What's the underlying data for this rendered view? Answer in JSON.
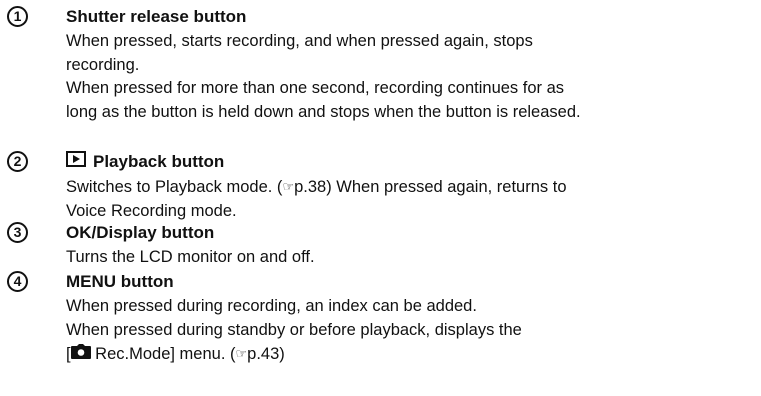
{
  "items": [
    {
      "number": "1",
      "title": "Shutter release button",
      "lines": [
        "When pressed, starts recording, and when pressed again, stops",
        "recording.",
        "When pressed for more than one second, recording continues for as",
        "long as the button is held down and stops when the button is released."
      ]
    },
    {
      "number": "2",
      "title": "Playback button",
      "title_icon": "playback-icon",
      "line1_prefix": "Switches to Playback mode. (",
      "line1_ref_glyph": "☞",
      "line1_suffix": "p.38) When pressed again, returns to",
      "line2": "Voice Recording mode."
    },
    {
      "number": "3",
      "title": "OK/Display button",
      "lines": [
        "Turns the LCD monitor on and off."
      ]
    },
    {
      "number": "4",
      "title": "MENU button",
      "lines": [
        "When pressed during recording, an index can be added.",
        "When pressed during standby or before playback, displays the"
      ],
      "last_line_open": "[",
      "last_line_icon": "camera-icon",
      "last_line_mid": " Rec.Mode] menu. (",
      "last_line_ref_glyph": "☞",
      "last_line_suffix": "p.43)"
    }
  ]
}
